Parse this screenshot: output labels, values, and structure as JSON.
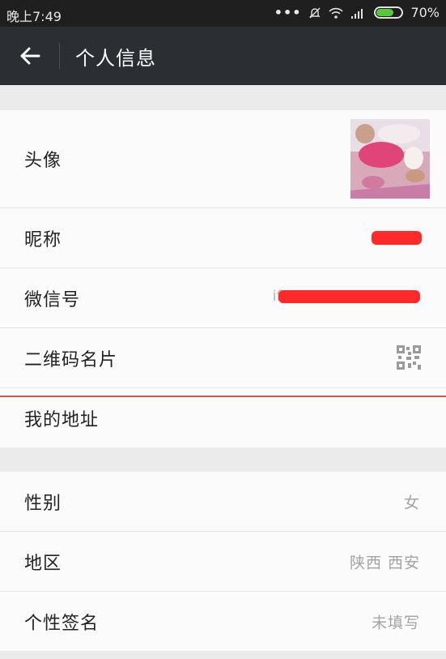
{
  "status_bar": {
    "time": "晚上7:49",
    "battery": "70%",
    "battery_level": 0.7,
    "icons": [
      "more-dots-icon",
      "mute-bell-icon",
      "wifi-icon",
      "signal-icon",
      "battery-icon"
    ]
  },
  "header": {
    "title": "个人信息",
    "back_icon": "arrow-left-icon"
  },
  "section1": {
    "avatar_label": "头像",
    "nickname_label": "昵称",
    "wechat_id_label": "微信号",
    "qr_label": "二维码名片",
    "qr_icon": "qr-code-icon",
    "address_label": "我的地址",
    "wechat_id_partial": "if"
  },
  "section2": {
    "gender_label": "性别",
    "gender_value": "女",
    "region_label": "地区",
    "region_value": "陕西 西安",
    "signature_label": "个性签名",
    "signature_value": "未填写"
  },
  "colors": {
    "status_bar": "#1f1f1f",
    "app_bar": "#2b2e33",
    "background": "#ebebeb",
    "row_bg": "#fbfbfb",
    "redaction": "#ff2a2a",
    "divider_accent": "#d9534f"
  }
}
